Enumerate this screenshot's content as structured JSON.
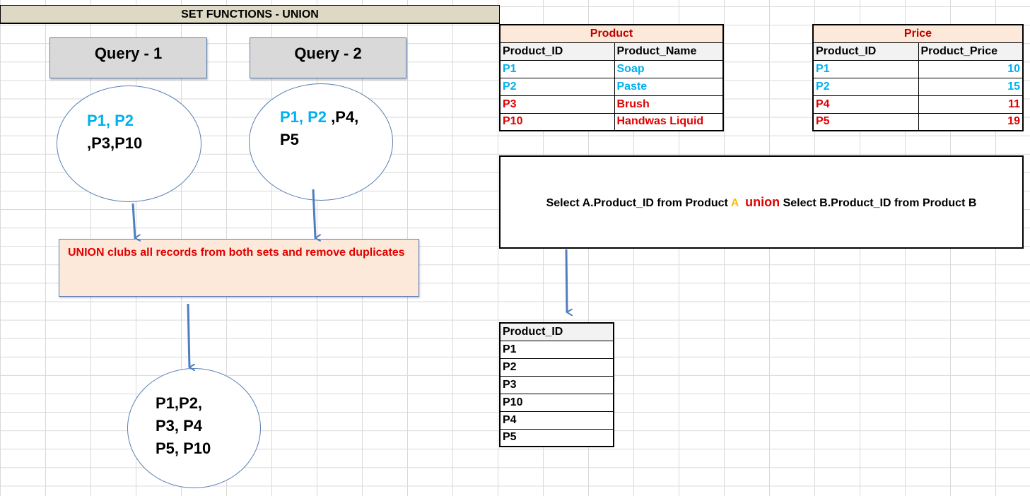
{
  "title": "SET FUNCTIONS - UNION",
  "query1": {
    "label": "Query - 1",
    "ids_highlight": "P1, P2",
    "ids_rest": ",P3,P10"
  },
  "query2": {
    "label": "Query - 2",
    "ids_highlight": "P1, P2",
    "ids_rest_inline": " ,P4,",
    "ids_rest_line2": "P5"
  },
  "union_note": "UNION clubs all records from both sets and remove duplicates",
  "result_ellipse": {
    "line1": "P1,P2,",
    "line2": "P3, P4",
    "line3": "P5, P10"
  },
  "product_table": {
    "caption": "Product",
    "headers": [
      "Product_ID",
      "Product_Name"
    ],
    "rows": [
      {
        "id": "P1",
        "name": "Soap",
        "color": "#00b0f0"
      },
      {
        "id": "P2",
        "name": "Paste",
        "color": "#00b0f0"
      },
      {
        "id": "P3",
        "name": "Brush",
        "color": "#e00000"
      },
      {
        "id": "P10",
        "name": "Handwas Liquid",
        "color": "#e00000"
      }
    ]
  },
  "price_table": {
    "caption": "Price",
    "headers": [
      "Product_ID",
      "Product_Price"
    ],
    "rows": [
      {
        "id": "P1",
        "price": "10",
        "color": "#00b0f0"
      },
      {
        "id": "P2",
        "price": "15",
        "color": "#00b0f0"
      },
      {
        "id": "P4",
        "price": "11",
        "color": "#e00000"
      },
      {
        "id": "P5",
        "price": "19",
        "color": "#e00000"
      }
    ]
  },
  "sql": {
    "part1": "Select A.Product_ID from Product ",
    "alias": "A",
    "keyword": "union",
    "part2": " Select B.Product_ID from Product B"
  },
  "result_table": {
    "header": "Product_ID",
    "rows": [
      "P1",
      "P2",
      "P3",
      "P10",
      "P4",
      "P5"
    ]
  },
  "colors": {
    "highlight_blue": "#00b0f0",
    "red": "#e00000",
    "dark_red": "#c00000",
    "alias_orange": "#ffc000",
    "arrow_blue": "#4f7ec0",
    "title_bg": "#ddd9c4",
    "note_bg": "#fde9d9"
  }
}
